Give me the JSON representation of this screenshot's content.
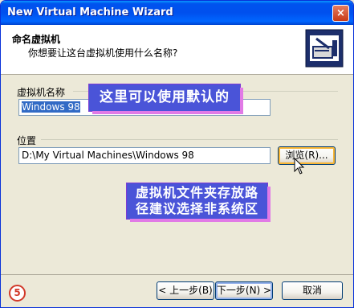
{
  "window": {
    "title": "New Virtual Machine Wizard",
    "close_glyph": "×"
  },
  "header": {
    "title": "命名虚拟机",
    "subtitle": "你想要让这台虚拟机使用什么名称?",
    "icon": "vm-wizard-icon"
  },
  "name_group": {
    "label": "虚拟机名称",
    "value": "Windows 98"
  },
  "location_group": {
    "label": "位置",
    "value": "D:\\My Virtual Machines\\Windows 98",
    "browse_label": "浏览(R)..."
  },
  "annotations": {
    "name_hint": "这里可以使用默认的",
    "location_hint_line1": "虚拟机文件夹存放路",
    "location_hint_line2": "径建议选择非系统区",
    "step_number": "5"
  },
  "footer": {
    "back_label": "< 上一步(B)",
    "next_label": "下一步(N) >",
    "cancel_label": "取消"
  },
  "colors": {
    "titlebar": "#0053ee",
    "annotation_bg": "#4a54d8",
    "annotation_shadow": "#e17ae6",
    "selection": "#316ac5"
  }
}
